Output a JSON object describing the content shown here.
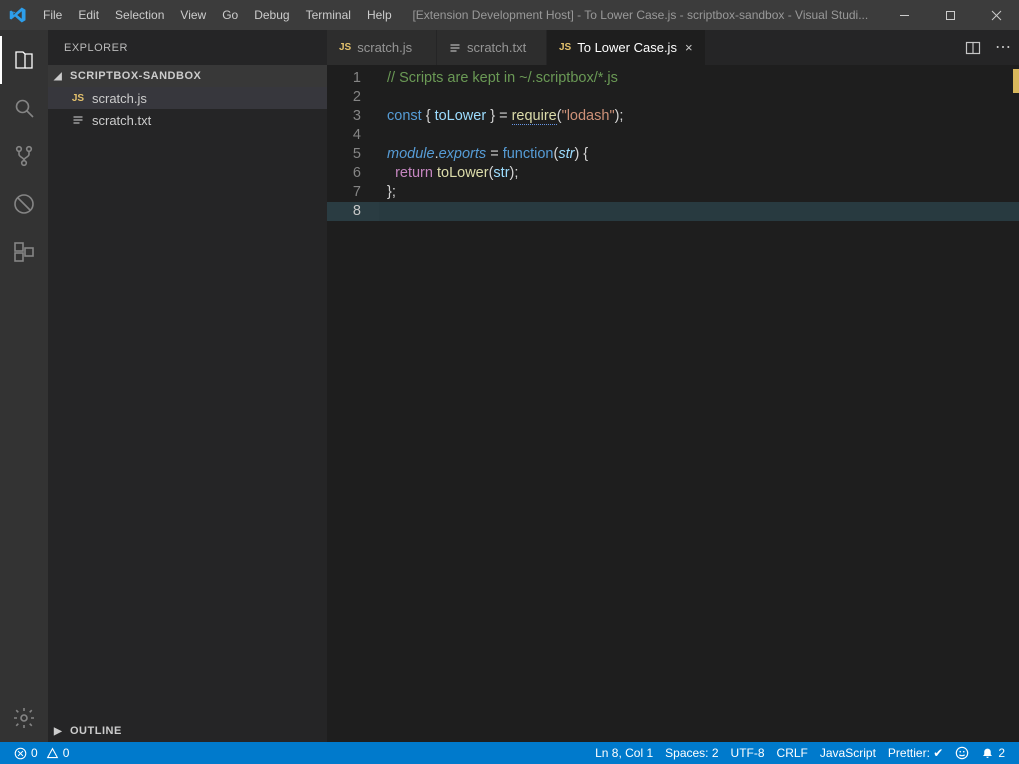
{
  "titlebar": {
    "menus": [
      "File",
      "Edit",
      "Selection",
      "View",
      "Go",
      "Debug",
      "Terminal",
      "Help"
    ],
    "title": "[Extension Development Host] - To Lower Case.js - scriptbox-sandbox - Visual Studi..."
  },
  "sidebar": {
    "title": "EXPLORER",
    "section": "SCRIPTBOX-SANDBOX",
    "outline": "OUTLINE",
    "files": [
      {
        "name": "scratch.js",
        "type": "js",
        "active": true
      },
      {
        "name": "scratch.txt",
        "type": "txt",
        "active": false
      }
    ]
  },
  "tabs": [
    {
      "name": "scratch.js",
      "type": "js",
      "active": false,
      "close": false
    },
    {
      "name": "scratch.txt",
      "type": "txt",
      "active": false,
      "close": false
    },
    {
      "name": "To Lower Case.js",
      "type": "js",
      "active": true,
      "close": true
    }
  ],
  "code": {
    "current_line": 8,
    "lines": [
      {
        "n": 1,
        "html": "<span class='c-comment'>// Scripts are kept in ~/.scriptbox/*.js</span>"
      },
      {
        "n": 2,
        "html": ""
      },
      {
        "n": 3,
        "html": "<span class='c-keyword'>const</span> <span class='c-punc'>{</span> <span class='c-var'>toLower</span> <span class='c-punc'>}</span> <span class='c-punc'>=</span> <span class='c-func underline-err'>require</span><span class='c-punc'>(</span><span class='c-string'>\"lodash\"</span><span class='c-punc'>);</span>"
      },
      {
        "n": 4,
        "html": ""
      },
      {
        "n": 5,
        "html": "<span class='c-keyword-it'>module</span><span class='c-punc'>.</span><span class='c-keyword-it'>exports</span> <span class='c-punc'>=</span> <span class='c-keyword'>function</span><span class='c-punc'>(</span><span class='c-var' style='font-style:italic'>str</span><span class='c-punc'>) {</span>"
      },
      {
        "n": 6,
        "html": "  <span class='c-control'>return</span> <span class='c-func'>toLower</span><span class='c-punc'>(</span><span class='c-var'>str</span><span class='c-punc'>);</span>"
      },
      {
        "n": 7,
        "html": "<span class='c-punc'>};</span>"
      },
      {
        "n": 8,
        "html": ""
      }
    ]
  },
  "status": {
    "errors": "0",
    "warnings": "0",
    "lncol": "Ln 8, Col 1",
    "spaces": "Spaces: 2",
    "encoding": "UTF-8",
    "eol": "CRLF",
    "lang": "JavaScript",
    "prettier": "Prettier: ✔",
    "bell": "2"
  }
}
